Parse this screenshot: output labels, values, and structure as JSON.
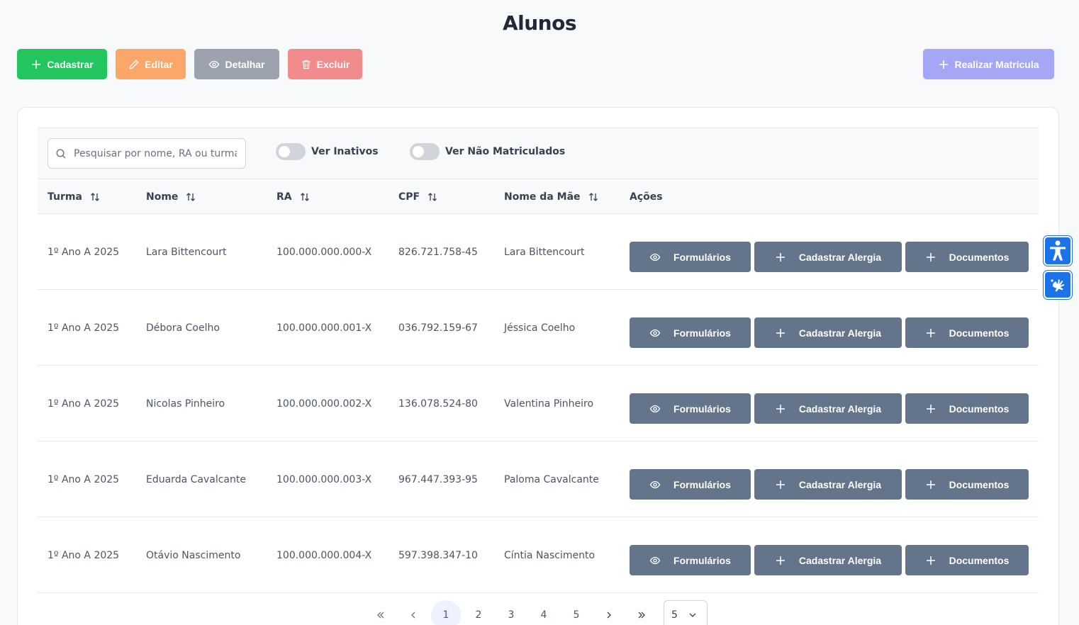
{
  "page": {
    "title": "Alunos"
  },
  "toolbar": {
    "cadastrar": "Cadastrar",
    "editar": "Editar",
    "detalhar": "Detalhar",
    "excluir": "Excluir",
    "matricula": "Realizar Matrícula"
  },
  "filters": {
    "search_placeholder": "Pesquisar por nome, RA ou turma",
    "search_value": "",
    "toggle_inativos": "Ver Inativos",
    "toggle_nao_matriculados": "Ver Não Matriculados"
  },
  "table": {
    "headers": [
      "Turma",
      "Nome",
      "RA",
      "CPF",
      "Nome da Mãe",
      "Ações"
    ],
    "action_labels": {
      "formularios": "Formulários",
      "alergia": "Cadastrar Alergia",
      "documentos": "Documentos"
    },
    "rows": [
      {
        "turma": "1º Ano A 2025",
        "nome": "Lara Bittencourt",
        "ra": "100.000.000.000-X",
        "cpf": "826.721.758-45",
        "mae": "Lara Bittencourt"
      },
      {
        "turma": "1º Ano A 2025",
        "nome": "Débora Coelho",
        "ra": "100.000.000.001-X",
        "cpf": "036.792.159-67",
        "mae": "Jéssica Coelho"
      },
      {
        "turma": "1º Ano A 2025",
        "nome": "Nicolas Pinheiro",
        "ra": "100.000.000.002-X",
        "cpf": "136.078.524-80",
        "mae": "Valentina Pinheiro"
      },
      {
        "turma": "1º Ano A 2025",
        "nome": "Eduarda Cavalcante",
        "ra": "100.000.000.003-X",
        "cpf": "967.447.393-95",
        "mae": "Paloma Cavalcante"
      },
      {
        "turma": "1º Ano A 2025",
        "nome": "Otávio Nascimento",
        "ra": "100.000.000.004-X",
        "cpf": "597.398.347-10",
        "mae": "Cíntia Nascimento"
      }
    ]
  },
  "pagination": {
    "pages": [
      "1",
      "2",
      "3",
      "4",
      "5"
    ],
    "current_page": "1",
    "rows_per_page": "5"
  },
  "colors": {
    "cadastrar": "#22c55e",
    "editar": "#fba76a",
    "detalhar": "#9ca3af",
    "excluir": "#f28b8b",
    "matricula": "#a5a6f6",
    "action": "#64748b",
    "accessibility": "#1a73e8"
  },
  "icons": {
    "cadastrar": "plus-icon",
    "editar": "pencil-icon",
    "detalhar": "eye-icon",
    "excluir": "trash-icon",
    "matricula": "plus-icon",
    "search": "search-icon",
    "sort": "sort-icon",
    "formularios": "eye-icon",
    "alergia": "plus-icon",
    "documentos": "plus-icon",
    "accessibility": "accessibility-icon",
    "sign_language": "sign-language-icon"
  }
}
